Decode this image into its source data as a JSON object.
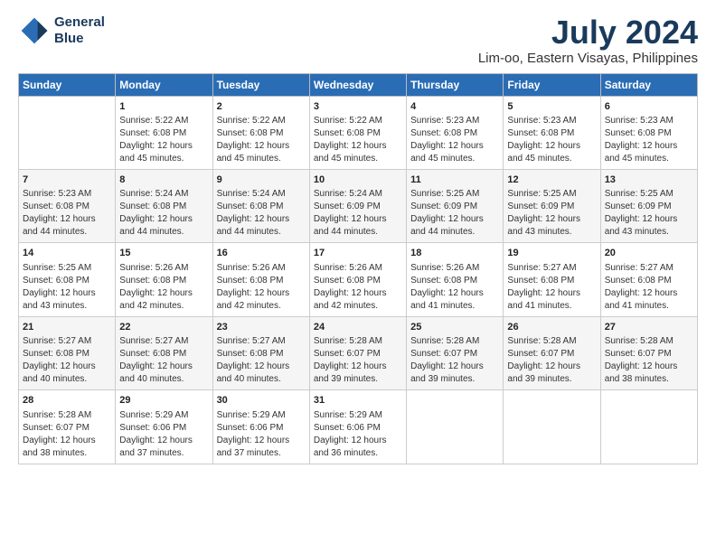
{
  "logo": {
    "line1": "General",
    "line2": "Blue"
  },
  "title": "July 2024",
  "subtitle": "Lim-oo, Eastern Visayas, Philippines",
  "header_days": [
    "Sunday",
    "Monday",
    "Tuesday",
    "Wednesday",
    "Thursday",
    "Friday",
    "Saturday"
  ],
  "weeks": [
    [
      {
        "day": "",
        "lines": []
      },
      {
        "day": "1",
        "lines": [
          "Sunrise: 5:22 AM",
          "Sunset: 6:08 PM",
          "Daylight: 12 hours",
          "and 45 minutes."
        ]
      },
      {
        "day": "2",
        "lines": [
          "Sunrise: 5:22 AM",
          "Sunset: 6:08 PM",
          "Daylight: 12 hours",
          "and 45 minutes."
        ]
      },
      {
        "day": "3",
        "lines": [
          "Sunrise: 5:22 AM",
          "Sunset: 6:08 PM",
          "Daylight: 12 hours",
          "and 45 minutes."
        ]
      },
      {
        "day": "4",
        "lines": [
          "Sunrise: 5:23 AM",
          "Sunset: 6:08 PM",
          "Daylight: 12 hours",
          "and 45 minutes."
        ]
      },
      {
        "day": "5",
        "lines": [
          "Sunrise: 5:23 AM",
          "Sunset: 6:08 PM",
          "Daylight: 12 hours",
          "and 45 minutes."
        ]
      },
      {
        "day": "6",
        "lines": [
          "Sunrise: 5:23 AM",
          "Sunset: 6:08 PM",
          "Daylight: 12 hours",
          "and 45 minutes."
        ]
      }
    ],
    [
      {
        "day": "7",
        "lines": [
          "Sunrise: 5:23 AM",
          "Sunset: 6:08 PM",
          "Daylight: 12 hours",
          "and 44 minutes."
        ]
      },
      {
        "day": "8",
        "lines": [
          "Sunrise: 5:24 AM",
          "Sunset: 6:08 PM",
          "Daylight: 12 hours",
          "and 44 minutes."
        ]
      },
      {
        "day": "9",
        "lines": [
          "Sunrise: 5:24 AM",
          "Sunset: 6:08 PM",
          "Daylight: 12 hours",
          "and 44 minutes."
        ]
      },
      {
        "day": "10",
        "lines": [
          "Sunrise: 5:24 AM",
          "Sunset: 6:09 PM",
          "Daylight: 12 hours",
          "and 44 minutes."
        ]
      },
      {
        "day": "11",
        "lines": [
          "Sunrise: 5:25 AM",
          "Sunset: 6:09 PM",
          "Daylight: 12 hours",
          "and 44 minutes."
        ]
      },
      {
        "day": "12",
        "lines": [
          "Sunrise: 5:25 AM",
          "Sunset: 6:09 PM",
          "Daylight: 12 hours",
          "and 43 minutes."
        ]
      },
      {
        "day": "13",
        "lines": [
          "Sunrise: 5:25 AM",
          "Sunset: 6:09 PM",
          "Daylight: 12 hours",
          "and 43 minutes."
        ]
      }
    ],
    [
      {
        "day": "14",
        "lines": [
          "Sunrise: 5:25 AM",
          "Sunset: 6:08 PM",
          "Daylight: 12 hours",
          "and 43 minutes."
        ]
      },
      {
        "day": "15",
        "lines": [
          "Sunrise: 5:26 AM",
          "Sunset: 6:08 PM",
          "Daylight: 12 hours",
          "and 42 minutes."
        ]
      },
      {
        "day": "16",
        "lines": [
          "Sunrise: 5:26 AM",
          "Sunset: 6:08 PM",
          "Daylight: 12 hours",
          "and 42 minutes."
        ]
      },
      {
        "day": "17",
        "lines": [
          "Sunrise: 5:26 AM",
          "Sunset: 6:08 PM",
          "Daylight: 12 hours",
          "and 42 minutes."
        ]
      },
      {
        "day": "18",
        "lines": [
          "Sunrise: 5:26 AM",
          "Sunset: 6:08 PM",
          "Daylight: 12 hours",
          "and 41 minutes."
        ]
      },
      {
        "day": "19",
        "lines": [
          "Sunrise: 5:27 AM",
          "Sunset: 6:08 PM",
          "Daylight: 12 hours",
          "and 41 minutes."
        ]
      },
      {
        "day": "20",
        "lines": [
          "Sunrise: 5:27 AM",
          "Sunset: 6:08 PM",
          "Daylight: 12 hours",
          "and 41 minutes."
        ]
      }
    ],
    [
      {
        "day": "21",
        "lines": [
          "Sunrise: 5:27 AM",
          "Sunset: 6:08 PM",
          "Daylight: 12 hours",
          "and 40 minutes."
        ]
      },
      {
        "day": "22",
        "lines": [
          "Sunrise: 5:27 AM",
          "Sunset: 6:08 PM",
          "Daylight: 12 hours",
          "and 40 minutes."
        ]
      },
      {
        "day": "23",
        "lines": [
          "Sunrise: 5:27 AM",
          "Sunset: 6:08 PM",
          "Daylight: 12 hours",
          "and 40 minutes."
        ]
      },
      {
        "day": "24",
        "lines": [
          "Sunrise: 5:28 AM",
          "Sunset: 6:07 PM",
          "Daylight: 12 hours",
          "and 39 minutes."
        ]
      },
      {
        "day": "25",
        "lines": [
          "Sunrise: 5:28 AM",
          "Sunset: 6:07 PM",
          "Daylight: 12 hours",
          "and 39 minutes."
        ]
      },
      {
        "day": "26",
        "lines": [
          "Sunrise: 5:28 AM",
          "Sunset: 6:07 PM",
          "Daylight: 12 hours",
          "and 39 minutes."
        ]
      },
      {
        "day": "27",
        "lines": [
          "Sunrise: 5:28 AM",
          "Sunset: 6:07 PM",
          "Daylight: 12 hours",
          "and 38 minutes."
        ]
      }
    ],
    [
      {
        "day": "28",
        "lines": [
          "Sunrise: 5:28 AM",
          "Sunset: 6:07 PM",
          "Daylight: 12 hours",
          "and 38 minutes."
        ]
      },
      {
        "day": "29",
        "lines": [
          "Sunrise: 5:29 AM",
          "Sunset: 6:06 PM",
          "Daylight: 12 hours",
          "and 37 minutes."
        ]
      },
      {
        "day": "30",
        "lines": [
          "Sunrise: 5:29 AM",
          "Sunset: 6:06 PM",
          "Daylight: 12 hours",
          "and 37 minutes."
        ]
      },
      {
        "day": "31",
        "lines": [
          "Sunrise: 5:29 AM",
          "Sunset: 6:06 PM",
          "Daylight: 12 hours",
          "and 36 minutes."
        ]
      },
      {
        "day": "",
        "lines": []
      },
      {
        "day": "",
        "lines": []
      },
      {
        "day": "",
        "lines": []
      }
    ]
  ]
}
